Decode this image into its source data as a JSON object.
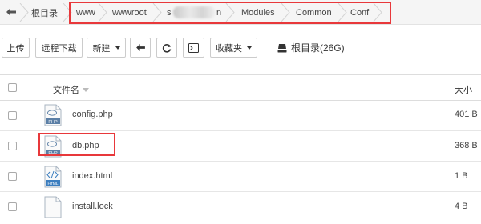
{
  "breadcrumb": {
    "root": "根目录",
    "segments": [
      "www",
      "wwwroot",
      "s",
      "n",
      "Modules",
      "Common",
      "Conf"
    ]
  },
  "toolbar": {
    "upload": "上传",
    "remote_download": "远程下载",
    "new": "新建",
    "favorites": "收藏夹",
    "disk_label": "根目录(26G)"
  },
  "table": {
    "col_name": "文件名",
    "col_size": "大小",
    "files": [
      {
        "name": "config.php",
        "size": "401 B",
        "icon": "php-file-icon",
        "icon_label": "PHP"
      },
      {
        "name": "db.php",
        "size": "368 B",
        "icon": "php-file-icon",
        "icon_label": "PHP"
      },
      {
        "name": "index.html",
        "size": "1 B",
        "icon": "html-file-icon",
        "icon_label": "HTML"
      },
      {
        "name": "install.lock",
        "size": "4 B",
        "icon": "blank-file-icon",
        "icon_label": ""
      }
    ]
  },
  "colors": {
    "highlight": "#e8383b",
    "php_icon": "#5b7fa6",
    "html_icon": "#3c7ebf"
  }
}
